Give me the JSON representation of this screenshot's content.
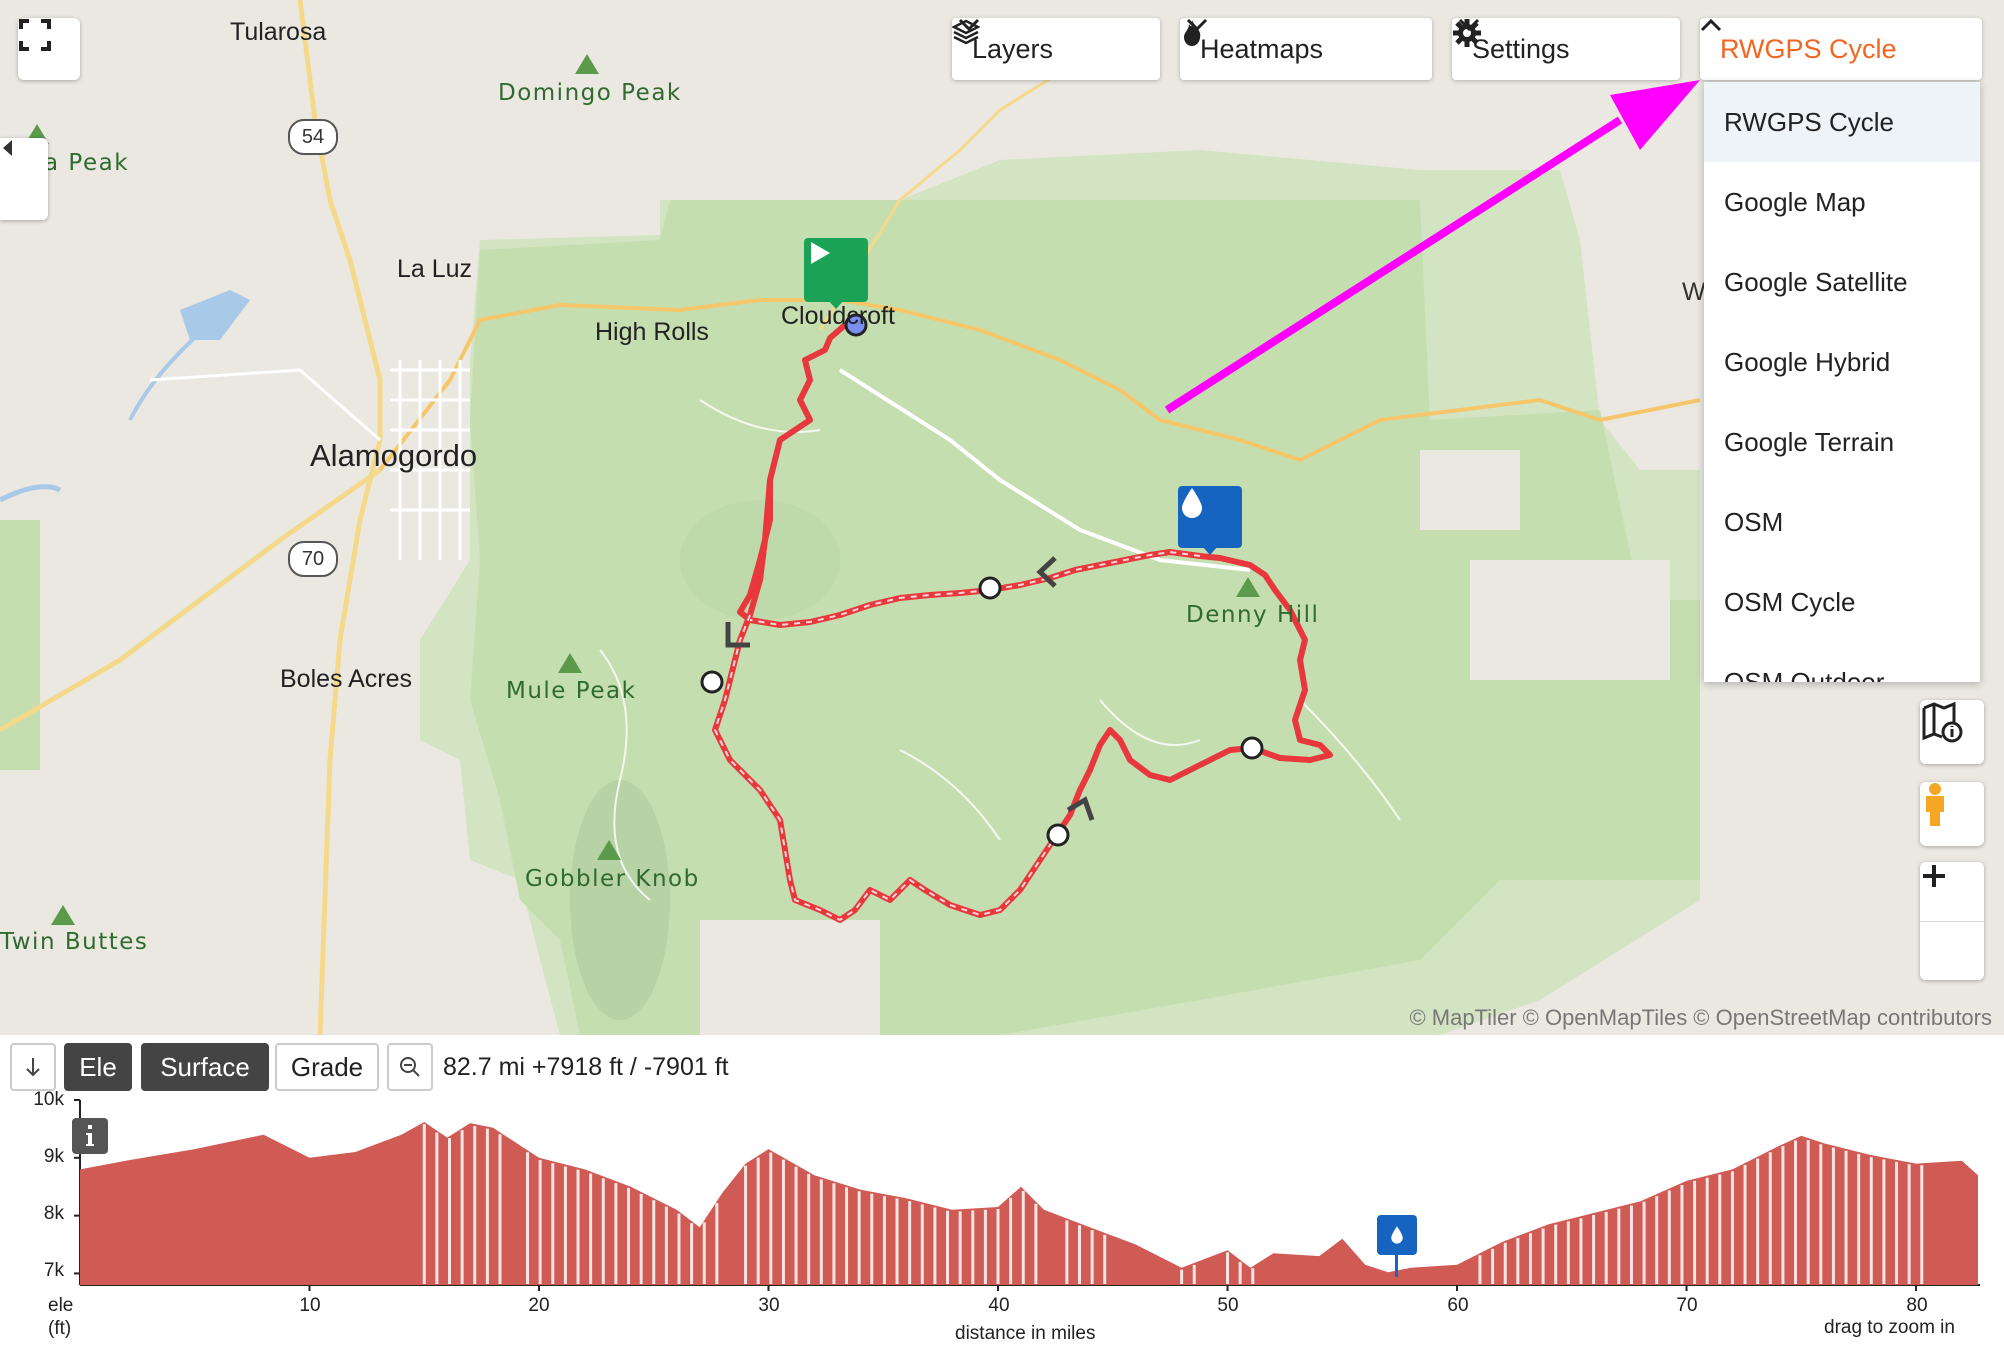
{
  "map": {
    "places": {
      "tularosa": "Tularosa",
      "la_luz": "La Luz",
      "high_rolls": "High Rolls",
      "cloudcroft": "Cloudcroft",
      "alamogordo": "Alamogordo",
      "boles_acres": "Boles Acres",
      "w_partial": "W"
    },
    "peaks": {
      "domingo": "Domingo Peak",
      "a_peak": "a Peak",
      "denny_hill": "Denny Hill",
      "mule_peak": "Mule Peak",
      "gobbler_knob": "Gobbler Knob",
      "twin_buttes": "Twin Buttes"
    },
    "roads": {
      "r54": "54",
      "r70": "70"
    },
    "attribution": "© MapTiler © OpenMapTiles © OpenStreetMap contributors",
    "route_color": "#e8383d",
    "forest_color": "#c5deb0",
    "annotation_arrow_color": "#ff00ff"
  },
  "toolbar": {
    "layers": "Layers",
    "heatmaps": "Heatmaps",
    "settings": "Settings",
    "map_style": "RWGPS Cycle",
    "map_style_color": "#f26522"
  },
  "dropdown": {
    "options": [
      "RWGPS Cycle",
      "Google Map",
      "Google Satellite",
      "Google Hybrid",
      "Google Terrain",
      "OSM",
      "OSM Cycle",
      "OSM Outdoor"
    ],
    "selected": "RWGPS Cycle"
  },
  "icons": {
    "fullscreen": "fullscreen-icon",
    "collapse": "chevron-left-icon",
    "map_info": "map-info-icon",
    "street_view": "pegman-icon",
    "zoom_in": "plus-icon",
    "zoom_out": "minus-icon",
    "start": "play-icon",
    "water": "water-drop-icon"
  },
  "profile": {
    "buttons": {
      "ele": "Ele",
      "surface": "Surface",
      "grade": "Grade"
    },
    "stats": "82.7 mi +7918 ft / -7901 ft",
    "y_ticks": [
      "10k",
      "9k",
      "8k",
      "7k"
    ],
    "y_label_1": "ele",
    "y_label_2": "(ft)",
    "x_ticks": [
      "10",
      "20",
      "30",
      "40",
      "50",
      "60",
      "70",
      "80"
    ],
    "x_label": "distance in miles",
    "hint": "drag to zoom in",
    "fill_color": "#d05a54"
  },
  "chart_data": {
    "type": "area",
    "xlabel": "distance in miles",
    "ylabel": "ele (ft)",
    "xlim": [
      0,
      82.7
    ],
    "ylim": [
      6800,
      10000
    ],
    "x": [
      0,
      2,
      5,
      8,
      10,
      12,
      14,
      15,
      16,
      17,
      18,
      20,
      22,
      24,
      26,
      27,
      28,
      29,
      30,
      32,
      34,
      36,
      38,
      40,
      41,
      42,
      44,
      46,
      48,
      50,
      51,
      52,
      54,
      55,
      56,
      57,
      58,
      60,
      62,
      64,
      66,
      68,
      70,
      72,
      74,
      75,
      76,
      78,
      80,
      82,
      82.7
    ],
    "series": [
      {
        "values": [
          8800,
          8950,
          9150,
          9400,
          9000,
          9100,
          9400,
          9620,
          9350,
          9600,
          9520,
          9000,
          8800,
          8500,
          8100,
          7800,
          8400,
          8900,
          9150,
          8700,
          8450,
          8300,
          8100,
          8150,
          8500,
          8100,
          7800,
          7500,
          7100,
          7400,
          7100,
          7350,
          7300,
          7600,
          7150,
          7020,
          7100,
          7150,
          7550,
          7850,
          8050,
          8250,
          8600,
          8800,
          9200,
          9380,
          9250,
          9050,
          8900,
          8950,
          8700
        ]
      }
    ]
  }
}
